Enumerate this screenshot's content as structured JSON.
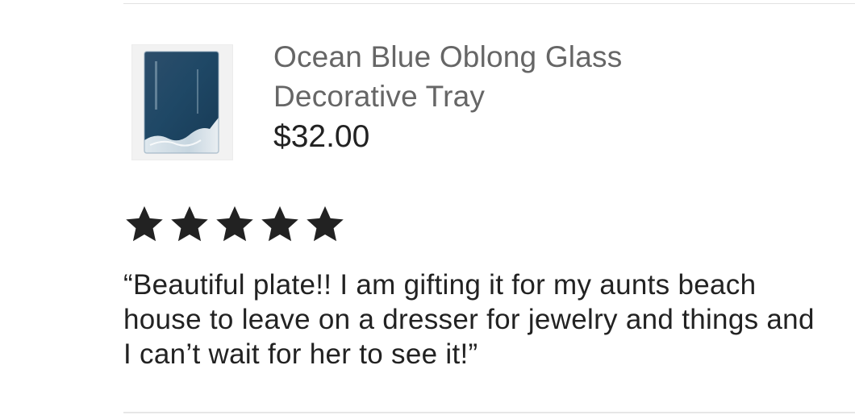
{
  "listing": {
    "image_alt": "Ocean Blue Oblong Glass Decorative Tray product photo",
    "title": "Ocean Blue Oblong Glass Decorative Tray",
    "price": "$32.00"
  },
  "review": {
    "rating": 5,
    "rating_max": 5,
    "star_icon": "star-icon",
    "star_color": "#222222",
    "text": "“Beautiful plate!! I am gifting it for my aunts beach house to leave on a dresser for jewelry and things and I can’t wait for her to see it!”"
  }
}
